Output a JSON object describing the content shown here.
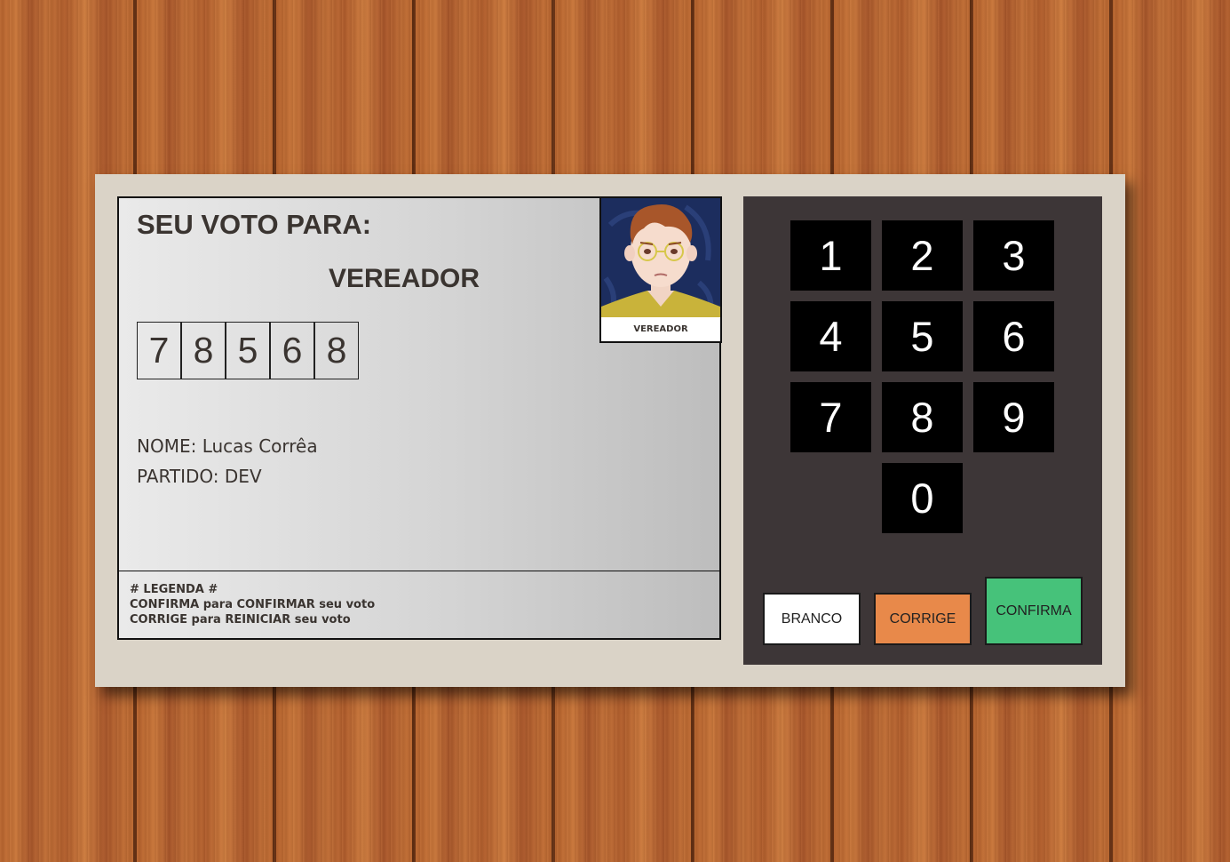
{
  "screen": {
    "title": "SEU VOTO PARA:",
    "role": "VEREADOR",
    "digits": [
      "7",
      "8",
      "5",
      "6",
      "8"
    ],
    "name_label": "NOME: Lucas Corrêa",
    "party_label": "PARTIDO: DEV",
    "photo_caption": "VEREADOR",
    "legend": {
      "line1": "# LEGENDA #",
      "line2": "CONFIRMA para CONFIRMAR seu voto",
      "line3": "CORRIGE para REINICIAR seu voto"
    }
  },
  "keypad": {
    "keys": [
      "1",
      "2",
      "3",
      "4",
      "5",
      "6",
      "7",
      "8",
      "9",
      "0"
    ],
    "branco": "BRANCO",
    "corrige": "CORRIGE",
    "confirma": "CONFIRMA"
  },
  "colors": {
    "branco": "#ffffff",
    "corrige": "#e8894a",
    "confirma": "#46c27a",
    "keypad_bg": "#3d3637",
    "machine_bg": "#dad3c7"
  }
}
